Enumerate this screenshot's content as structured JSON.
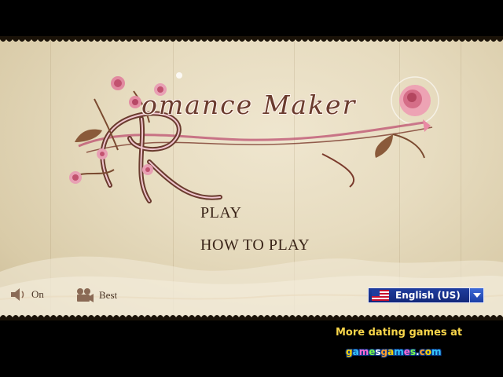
{
  "game": {
    "title_initial": "R",
    "title_rest": "omance Maker"
  },
  "menu": {
    "play_label": "PLAY",
    "how_to_play_label": "HOW TO PLAY"
  },
  "controls": {
    "sound_label": "On",
    "quality_label": "Best"
  },
  "language": {
    "selected": "English (US)"
  },
  "footer": {
    "promo_text": "More dating games at",
    "brand": "gamesgames.com"
  },
  "colors": {
    "parchment": "#e7dcc0",
    "menu_text": "#3a2418",
    "promo_text": "#f7d54a",
    "select_bg": "#1f3d9e"
  }
}
